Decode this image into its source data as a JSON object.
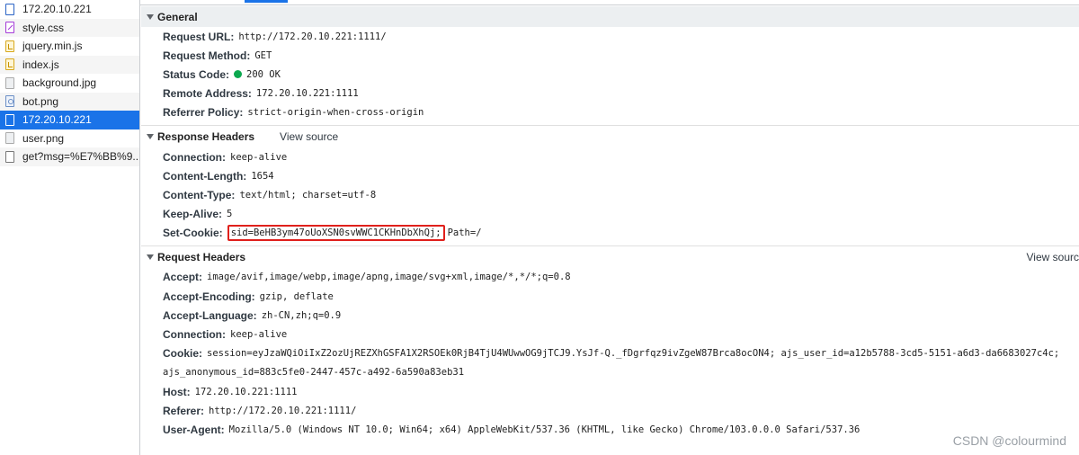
{
  "requests": [
    {
      "name": "172.20.10.221",
      "icon": "document-icon"
    },
    {
      "name": "style.css",
      "icon": "stylesheet-icon"
    },
    {
      "name": "jquery.min.js",
      "icon": "script-icon"
    },
    {
      "name": "index.js",
      "icon": "script-icon"
    },
    {
      "name": "background.jpg",
      "icon": "image-icon"
    },
    {
      "name": "bot.png",
      "icon": "image-icon"
    },
    {
      "name": "172.20.10.221",
      "icon": "document-icon",
      "selected": true
    },
    {
      "name": "user.png",
      "icon": "image-icon"
    },
    {
      "name": "get?msg=%E7%BB%9...",
      "icon": "file-icon"
    }
  ],
  "general": {
    "title": "General",
    "request_url_label": "Request URL:",
    "request_url": "http://172.20.10.221:1111/",
    "request_method_label": "Request Method:",
    "request_method": "GET",
    "status_code_label": "Status Code:",
    "status_code": "200 OK",
    "status_color": "#0ca84f",
    "remote_address_label": "Remote Address:",
    "remote_address": "172.20.10.221:1111",
    "referrer_policy_label": "Referrer Policy:",
    "referrer_policy": "strict-origin-when-cross-origin"
  },
  "response_headers": {
    "title": "Response Headers",
    "view_source": "View source",
    "connection_label": "Connection:",
    "connection": "keep-alive",
    "content_length_label": "Content-Length:",
    "content_length": "1654",
    "content_type_label": "Content-Type:",
    "content_type": "text/html; charset=utf-8",
    "keep_alive_label": "Keep-Alive:",
    "keep_alive": "5",
    "set_cookie_label": "Set-Cookie:",
    "set_cookie_highlighted": "sid=BeHB3ym47oUoXSN0svWWC1CKHnDbXhQj;",
    "set_cookie_rest": "Path=/",
    "highlight_color": "#e0201c"
  },
  "request_headers": {
    "title": "Request Headers",
    "view_source": "View sourc",
    "accept_label": "Accept:",
    "accept": "image/avif,image/webp,image/apng,image/svg+xml,image/*,*/*;q=0.8",
    "accept_encoding_label": "Accept-Encoding:",
    "accept_encoding": "gzip, deflate",
    "accept_language_label": "Accept-Language:",
    "accept_language": "zh-CN,zh;q=0.9",
    "connection_label": "Connection:",
    "connection": "keep-alive",
    "cookie_label": "Cookie:",
    "cookie_line1": "session=eyJzaWQiOiIxZ2ozUjREZXhGSFA1X2RSOEk0RjB4TjU4WUwwOG9jTCJ9.YsJf-Q._fDgrfqz9ivZgeW87Brca8ocON4; ajs_user_id=a12b5788-3cd5-5151-a6d3-da6683027c4c;",
    "cookie_line2": "ajs_anonymous_id=883c5fe0-2447-457c-a492-6a590a83eb31",
    "host_label": "Host:",
    "host": "172.20.10.221:1111",
    "referer_label": "Referer:",
    "referer": "http://172.20.10.221:1111/",
    "user_agent_label": "User-Agent:",
    "user_agent": "Mozilla/5.0 (Windows NT 10.0; Win64; x64) AppleWebKit/537.36 (KHTML, like Gecko) Chrome/103.0.0.0 Safari/537.36"
  },
  "watermark": "CSDN @colourmind"
}
